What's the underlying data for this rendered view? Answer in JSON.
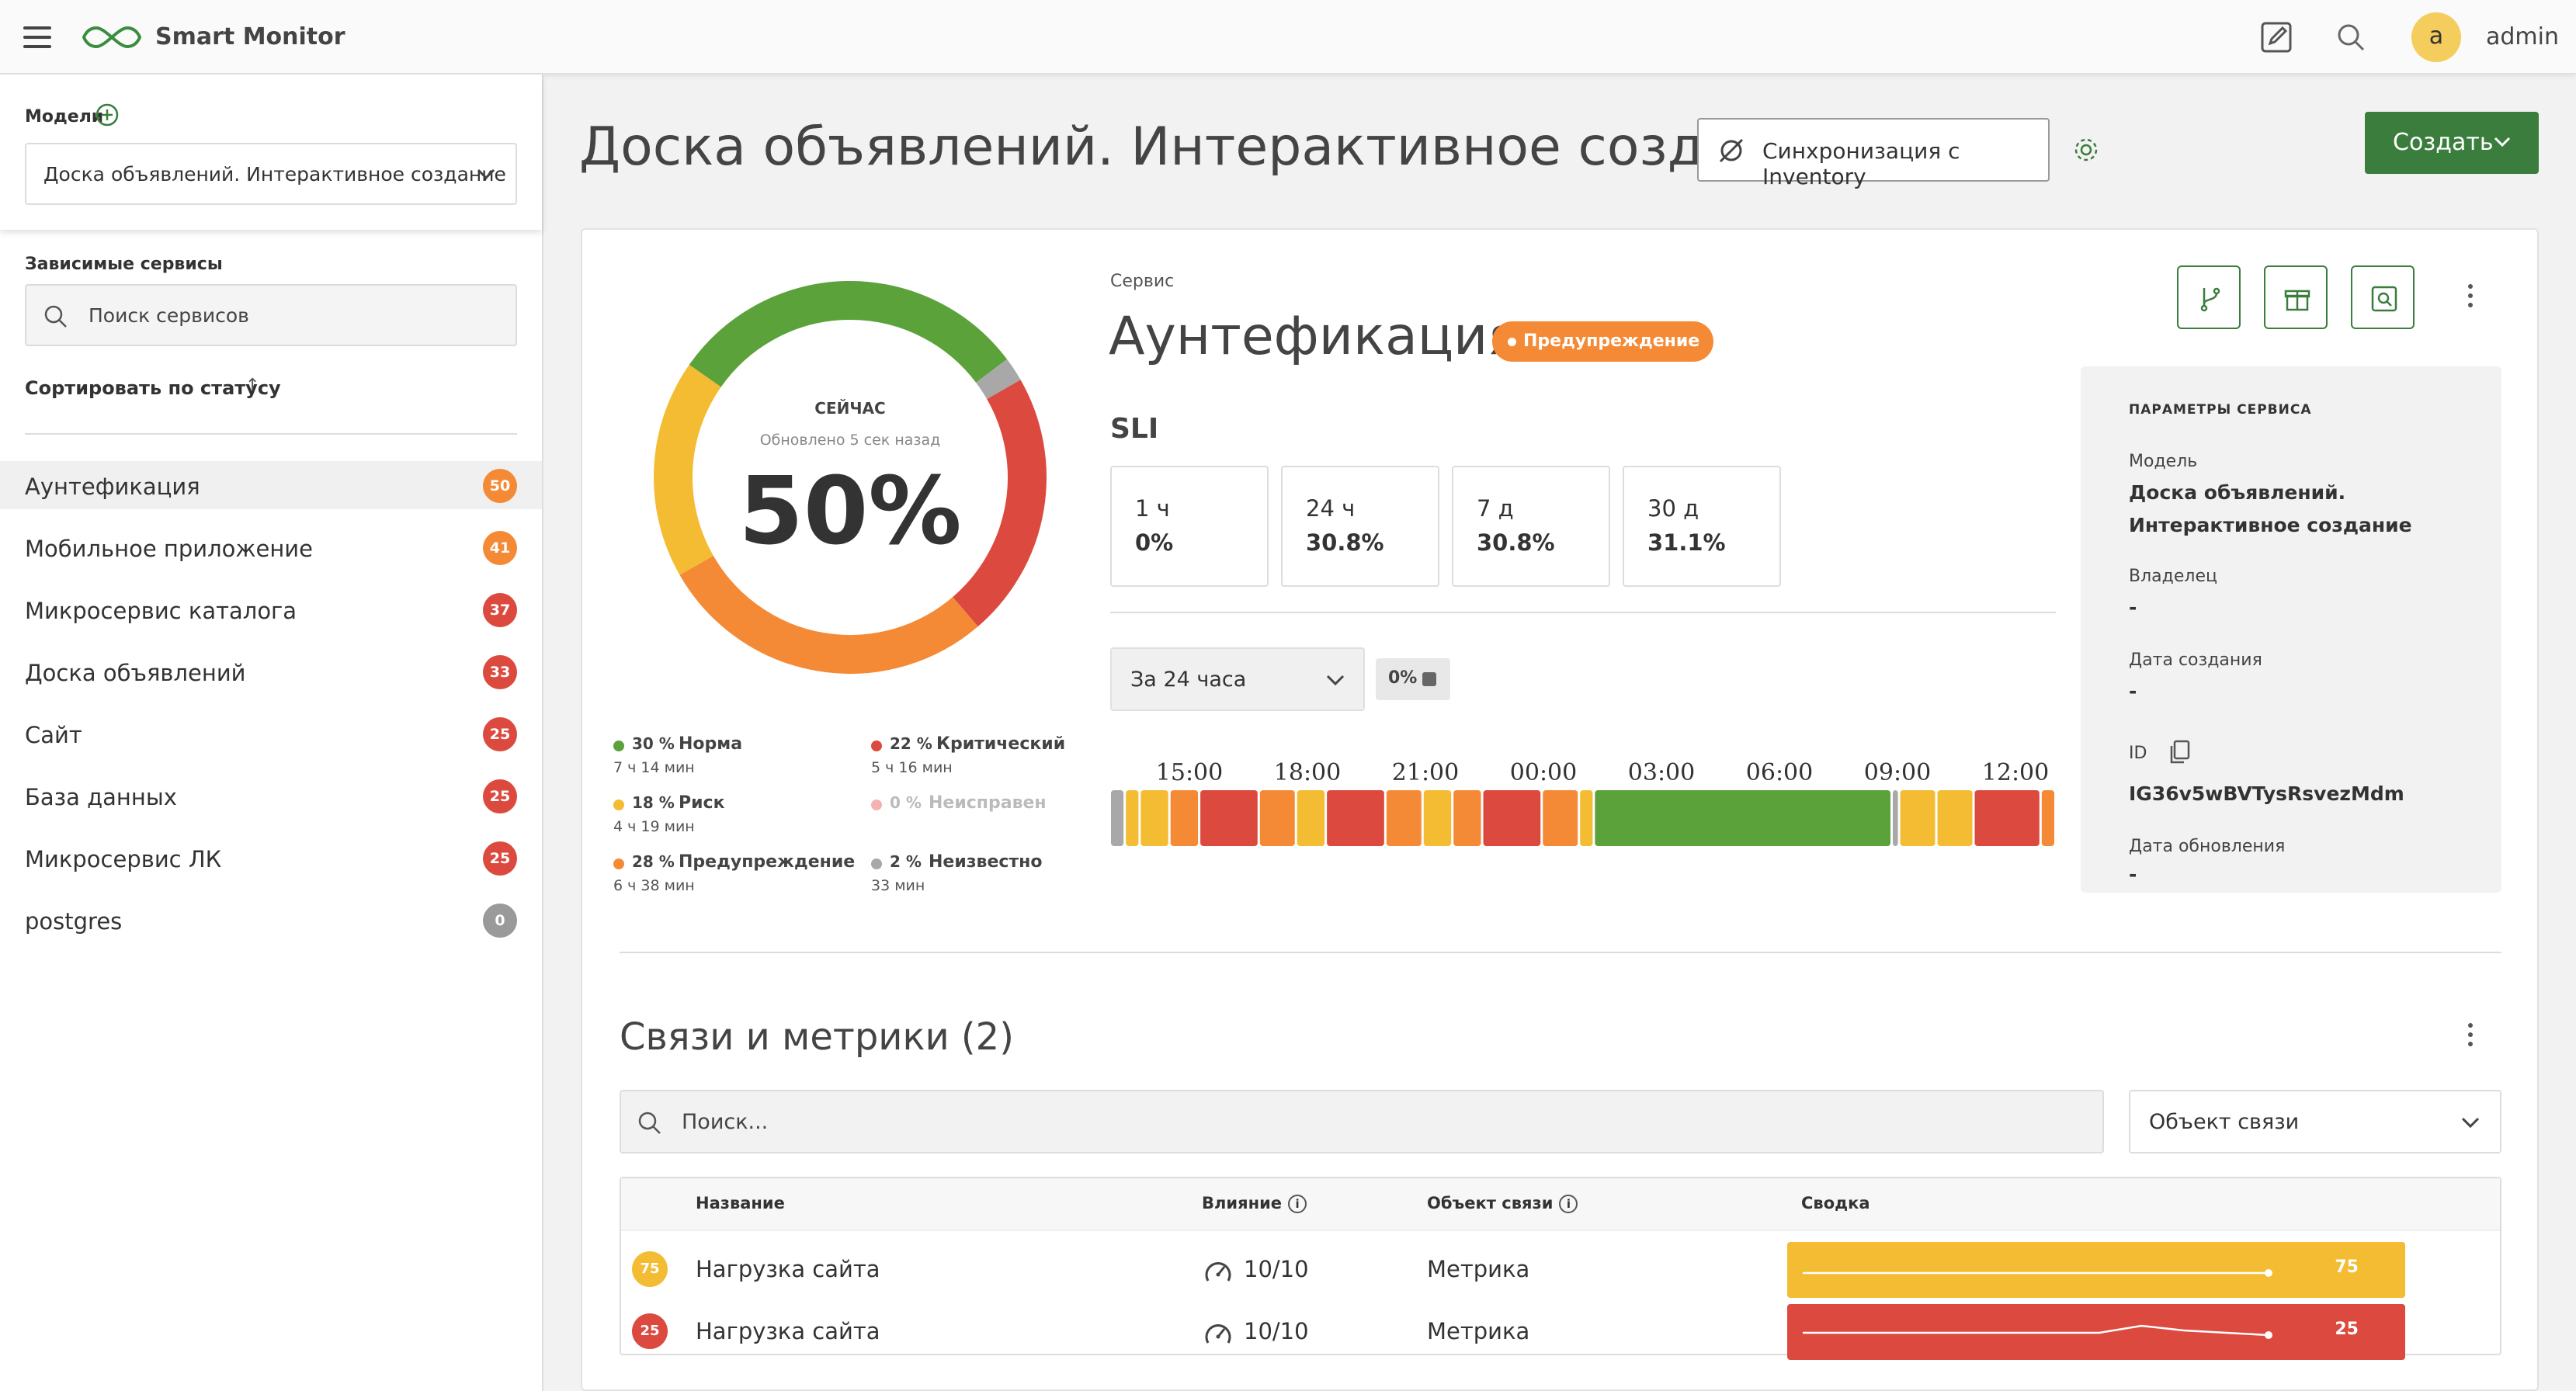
{
  "header": {
    "app_title": "Smart Monitor",
    "user_initial": "a",
    "username": "admin"
  },
  "sidebar": {
    "models_label": "Модели",
    "model_selected": "Доска объявлений. Интерактивное создание",
    "dependent_label": "Зависимые сервисы",
    "search_placeholder": "Поиск сервисов",
    "sort_label": "Сортировать по статусу",
    "items": [
      {
        "name": "Аунтефикация",
        "score": "50",
        "color": "#f58a36"
      },
      {
        "name": "Мобильное приложение",
        "score": "41",
        "color": "#f58a36"
      },
      {
        "name": "Микросервис каталога",
        "score": "37",
        "color": "#dc4a3f"
      },
      {
        "name": "Доска объявлений",
        "score": "33",
        "color": "#dc4a3f"
      },
      {
        "name": "Сайт",
        "score": "25",
        "color": "#dc4a3f"
      },
      {
        "name": "База данных",
        "score": "25",
        "color": "#dc4a3f"
      },
      {
        "name": "Микросервис ЛК",
        "score": "25",
        "color": "#dc4a3f"
      },
      {
        "name": "postgres",
        "score": "0",
        "color": "#9a9a9a"
      }
    ]
  },
  "main": {
    "title": "Доска объявлений. Интерактивное создание",
    "sync_label": "Синхронизация с Inventory",
    "create_label": "Создать"
  },
  "service": {
    "caption": "Сервис",
    "name": "Аунтефикация",
    "status": "Предупреждение",
    "now_label": "СЕЙЧАС",
    "updated": "Обновлено 5 сек назад",
    "big_value": "50%",
    "donut": [
      {
        "name": "Норма",
        "fraction": 0.3,
        "color": "#5ba23a"
      },
      {
        "name": "Неизвестно",
        "fraction": 0.02,
        "color": "#a8a8a8"
      },
      {
        "name": "Критический",
        "fraction": 0.22,
        "color": "#dc4a3f"
      },
      {
        "name": "Предупреждение",
        "fraction": 0.28,
        "color": "#f58a36"
      },
      {
        "name": "Риск",
        "fraction": 0.18,
        "color": "#f4bc33"
      }
    ],
    "legend": [
      {
        "pct": "30 %",
        "name": "Норма",
        "dur": "7 ч 14 мин",
        "color": "#5ba23a"
      },
      {
        "pct": "22 %",
        "name": "Критический",
        "dur": "5 ч 16 мин",
        "color": "#dc4a3f"
      },
      {
        "pct": "18 %",
        "name": "Риск",
        "dur": "4 ч 19 мин",
        "color": "#f4bc33"
      },
      {
        "pct": "0 %",
        "name": "Неисправен",
        "dur": "",
        "color": "#f3b3b3"
      },
      {
        "pct": "28 %",
        "name": "Предупреждение",
        "dur": "6 ч 38 мин",
        "color": "#f58a36"
      },
      {
        "pct": "2 %",
        "name": "Неизвестно",
        "dur": "33 мин",
        "color": "#a8a8a8"
      }
    ],
    "sli_title": "SLI",
    "sli": [
      {
        "period": "1 ч",
        "value": "0%"
      },
      {
        "period": "24 ч",
        "value": "30.8%"
      },
      {
        "period": "7 д",
        "value": "30.8%"
      },
      {
        "period": "30 д",
        "value": "31.1%"
      }
    ],
    "range_label": "За 24 часа",
    "range_chip": "0%",
    "time_ticks": [
      "15:00",
      "18:00",
      "21:00",
      "00:00",
      "03:00",
      "06:00",
      "09:00",
      "12:00"
    ],
    "timeline": [
      {
        "w": 1,
        "c": "#a8a8a8"
      },
      {
        "w": 1,
        "c": "#f4bc33"
      },
      {
        "w": 2,
        "c": "#f4bc33"
      },
      {
        "w": 2,
        "c": "#f58a36"
      },
      {
        "w": 4,
        "c": "#dc4a3f"
      },
      {
        "w": 2.5,
        "c": "#f58a36"
      },
      {
        "w": 2,
        "c": "#f4bc33"
      },
      {
        "w": 4,
        "c": "#dc4a3f"
      },
      {
        "w": 2.5,
        "c": "#f58a36"
      },
      {
        "w": 2,
        "c": "#f4bc33"
      },
      {
        "w": 2,
        "c": "#f58a36"
      },
      {
        "w": 4,
        "c": "#dc4a3f"
      },
      {
        "w": 2.5,
        "c": "#f58a36"
      },
      {
        "w": 1,
        "c": "#f4bc33"
      },
      {
        "w": 20,
        "c": "#5ba23a"
      },
      {
        "w": 0.5,
        "c": "#a8a8a8"
      },
      {
        "w": 2.5,
        "c": "#f4bc33"
      },
      {
        "w": 2.5,
        "c": "#f4bc33"
      },
      {
        "w": 4.5,
        "c": "#dc4a3f"
      },
      {
        "w": 1,
        "c": "#f58a36"
      }
    ]
  },
  "params": {
    "title": "ПАРАМЕТРЫ СЕРВИСА",
    "model_label": "Модель",
    "model_value": "Доска объявлений. Интерактивное создание",
    "owner_label": "Владелец",
    "owner_value": "-",
    "created_label": "Дата создания",
    "created_value": "-",
    "id_label": "ID",
    "id_value": "IG36v5wBVTysRsvezMdm",
    "updated_label": "Дата обновления",
    "updated_value": "-"
  },
  "links": {
    "title": "Связи и метрики (2)",
    "search_placeholder": "Поиск...",
    "object_select": "Объект связи",
    "headers": {
      "name": "Название",
      "impact": "Влияние",
      "object": "Объект связи",
      "summary": "Сводка"
    },
    "rows": [
      {
        "score": "75",
        "color": "#f4bc33",
        "name": "Нагрузка сайта",
        "impact": "10/10",
        "object": "Метрика",
        "summary": "75",
        "trend": [
          75,
          75,
          75,
          75,
          75,
          75,
          75,
          75,
          75,
          75,
          75,
          75
        ]
      },
      {
        "score": "25",
        "color": "#dc4a3f",
        "name": "Нагрузка сайта",
        "impact": "10/10",
        "object": "Метрика",
        "summary": "25",
        "trend": [
          26,
          26,
          26,
          26,
          26,
          26,
          26,
          26,
          29,
          27,
          26,
          25
        ]
      }
    ]
  }
}
